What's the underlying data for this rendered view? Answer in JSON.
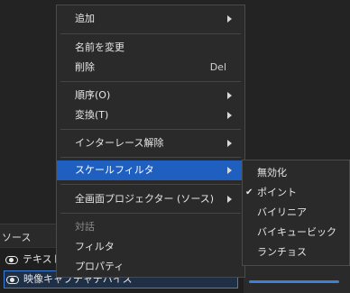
{
  "context_menu": {
    "items": [
      {
        "label": "追加"
      },
      {
        "label": "名前を変更"
      },
      {
        "label": "削除",
        "shortcut": "Del"
      },
      {
        "label": "順序(O)"
      },
      {
        "label": "変換(T)"
      },
      {
        "label": "インターレース解除"
      },
      {
        "label": "スケールフィルタ"
      },
      {
        "label": "全画面プロジェクター (ソース)"
      },
      {
        "label": "対話"
      },
      {
        "label": "フィルタ"
      },
      {
        "label": "プロパティ"
      }
    ]
  },
  "scale_filter_submenu": {
    "items": [
      {
        "label": "無効化"
      },
      {
        "label": "ポイント",
        "checked": "✔"
      },
      {
        "label": "バイリニア"
      },
      {
        "label": "バイキュービック"
      },
      {
        "label": "ランチョス"
      }
    ]
  },
  "sources_panel": {
    "title": "ソース",
    "items": [
      {
        "label": "テキスト"
      },
      {
        "label": "映像キャプチャデバイス"
      }
    ]
  },
  "colors": {
    "highlight": "#1f5fbf",
    "selection_border": "#3d7fd6"
  }
}
